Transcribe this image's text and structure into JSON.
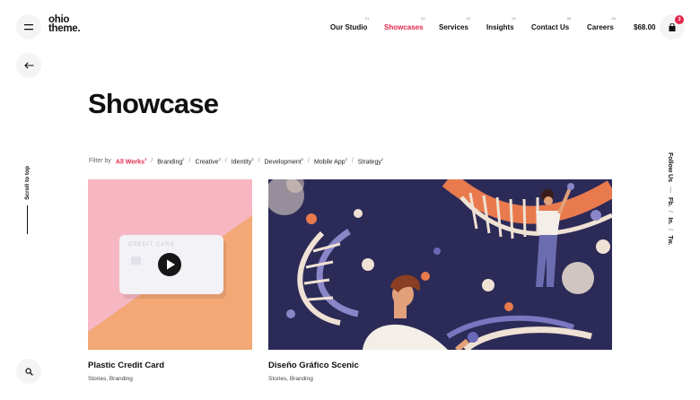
{
  "logo": {
    "line1": "ohio",
    "line2": "theme."
  },
  "nav": [
    {
      "num": "01",
      "label": "Our Studio",
      "active": false
    },
    {
      "num": "02",
      "label": "Showcases",
      "active": true
    },
    {
      "num": "03",
      "label": "Services",
      "active": false
    },
    {
      "num": "04",
      "label": "Insights",
      "active": false
    },
    {
      "num": "05",
      "label": "Contact Us",
      "active": false
    },
    {
      "num": "06",
      "label": "Careers",
      "active": false
    }
  ],
  "cart": {
    "price": "$68.00",
    "count": "3"
  },
  "sidebar": {
    "scroll_label": "Scroll to top"
  },
  "social": {
    "lead": "Follow Us",
    "sep": "—",
    "links": [
      "Fb.",
      "In.",
      "Tw."
    ],
    "divider": "/"
  },
  "page": {
    "title": "Showcase"
  },
  "filters": {
    "lead": "Filter by",
    "items": [
      {
        "label": "All Works",
        "count": "3",
        "active": true
      },
      {
        "label": "Branding",
        "count": "2",
        "active": false
      },
      {
        "label": "Creative",
        "count": "2",
        "active": false
      },
      {
        "label": "Identity",
        "count": "2",
        "active": false
      },
      {
        "label": "Development",
        "count": "2",
        "active": false
      },
      {
        "label": "Mobile App",
        "count": "2",
        "active": false
      },
      {
        "label": "Strategy",
        "count": "2",
        "active": false
      }
    ],
    "divider": "/"
  },
  "cards": [
    {
      "title": "Plastic Credit Card",
      "tags": "Stories, Branding",
      "card_text": "CREDIT CARD"
    },
    {
      "title": "Diseño Gráfico Scenic",
      "tags": "Stories, Branding"
    }
  ],
  "colors": {
    "accent": "#e4264b",
    "pink": "#f6b7c3",
    "orange": "#f3a876",
    "navy": "#2c2a57"
  }
}
